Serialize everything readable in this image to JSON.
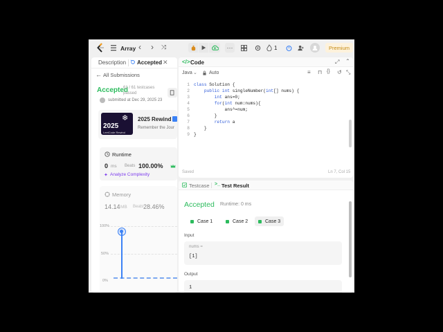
{
  "nav": {
    "problem_list_label": "Array",
    "prev": "‹",
    "next": "›",
    "shuffle": "⤨",
    "streak_count": "1",
    "premium_label": "Premium"
  },
  "left": {
    "tabs": [
      {
        "label": "Description"
      },
      {
        "label": "Accepted"
      }
    ],
    "all_submissions": "All Submissions",
    "status": "Accepted",
    "testcases": "61 / 61 testcases passed",
    "submitted_at": "submitted at Dec 29, 2025 23",
    "rewind_title": "2025 Rewind",
    "rewind_sub": "Remember the Jour",
    "badge_year": "2025",
    "badge_caption": "LeetCode Rewind",
    "runtime_label": "Runtime",
    "runtime_value": "0",
    "runtime_unit": "ms",
    "beats_label": "Beats",
    "runtime_beats": "100.00%",
    "analyze": "Analyze Complexity",
    "memory_label": "Memory",
    "memory_value": "14.14",
    "memory_unit": "MB",
    "memory_beats": "28.46%",
    "chart_ticks": [
      "100%",
      "50%",
      "0%"
    ]
  },
  "code": {
    "title": "Code",
    "language": "Java",
    "auto_label": "Auto",
    "lines": [
      {
        "n": "1",
        "text": "class Solution {"
      },
      {
        "n": "2",
        "text": "    public int singleNumber(int[] nums) {"
      },
      {
        "n": "3",
        "text": "        int ans=0;"
      },
      {
        "n": "4",
        "text": "        for(int num:nums){"
      },
      {
        "n": "5",
        "text": "            ans^=num;"
      },
      {
        "n": "6",
        "text": "        }"
      },
      {
        "n": "7",
        "text": "        return a"
      },
      {
        "n": "8",
        "text": "    }"
      },
      {
        "n": "9",
        "text": "}"
      }
    ],
    "saved": "Saved",
    "cursor_pos": "Ln 7, Col 15"
  },
  "test": {
    "tab_testcase": "Testcase",
    "tab_result": "Test Result",
    "status": "Accepted",
    "runtime": "Runtime: 0 ms",
    "cases": [
      "Case 1",
      "Case 2",
      "Case 3"
    ],
    "input_label": "Input",
    "input_var": "nums =",
    "input_value": "[1]",
    "output_label": "Output",
    "output_value": "1"
  }
}
